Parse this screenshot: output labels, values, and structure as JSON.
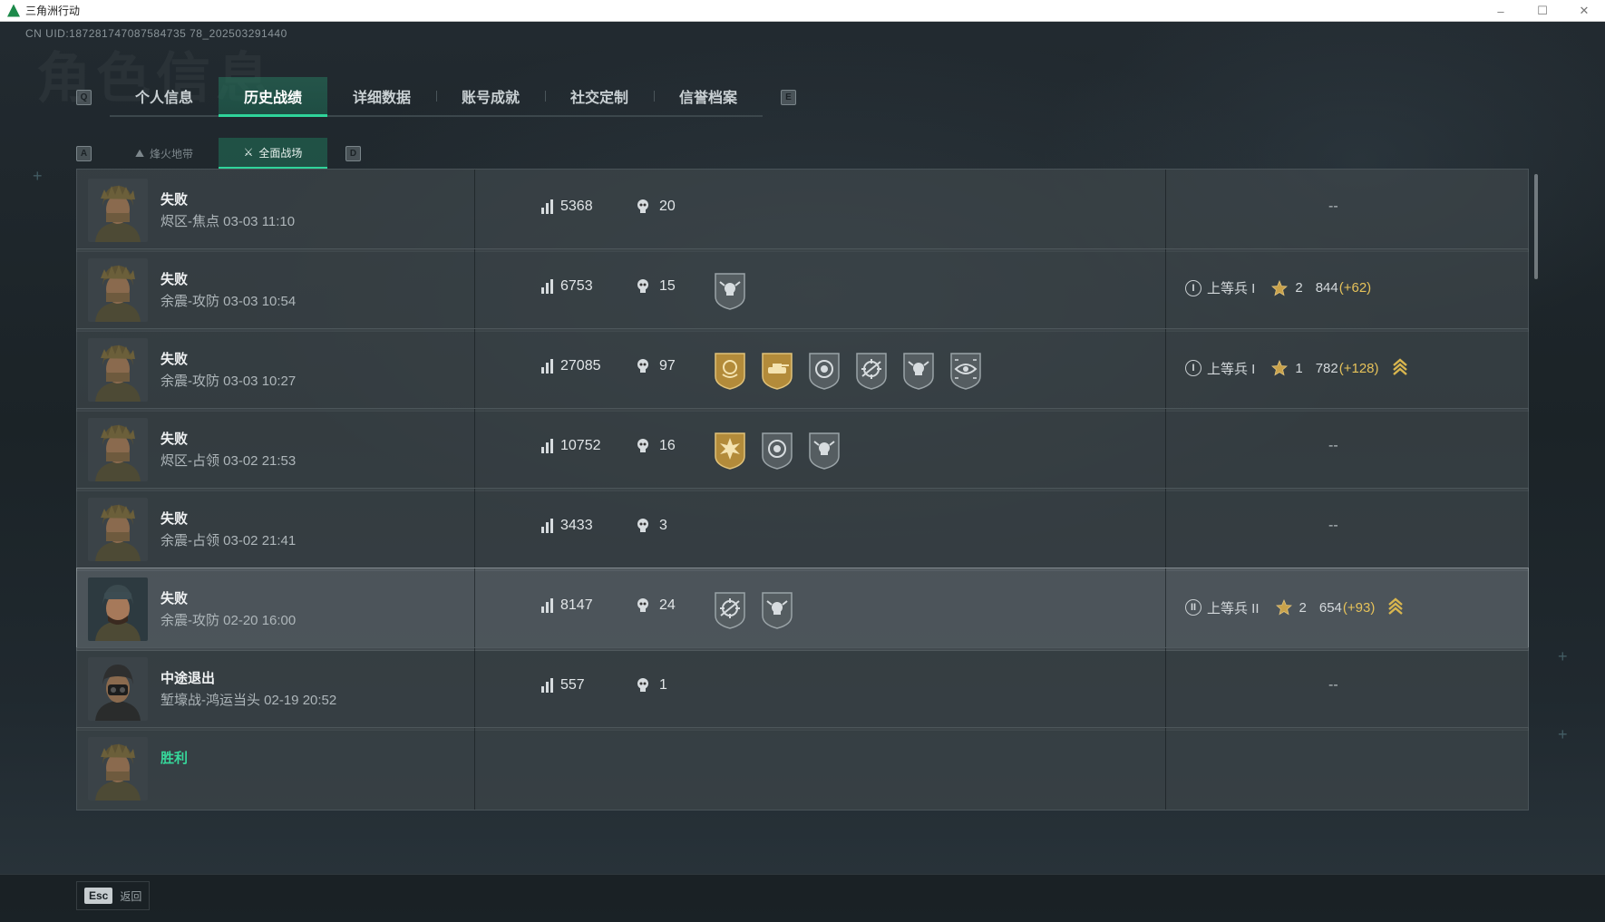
{
  "window": {
    "title": "三角洲行动",
    "controls": [
      "–",
      "☐",
      "✕"
    ]
  },
  "header": {
    "uid": "CN UID:187281747087584735 78_202503291440",
    "watermark": "角色信息"
  },
  "tabs": {
    "left_key": "Q",
    "right_key": "E",
    "items": [
      {
        "label": "个人信息"
      },
      {
        "label": "历史战绩"
      },
      {
        "label": "详细数据"
      },
      {
        "label": "账号成就"
      },
      {
        "label": "社交定制"
      },
      {
        "label": "信誉档案"
      }
    ],
    "active_index": 1
  },
  "subtabs": {
    "left_key": "A",
    "right_key": "D",
    "items": [
      {
        "label": "烽火地带"
      },
      {
        "label": "全面战场"
      }
    ],
    "active_index": 1
  },
  "rows": [
    {
      "result": "失败",
      "match": "烬区-焦点 03-03 11:10",
      "score": "5368",
      "kills": "20",
      "medals": [],
      "empty": "--",
      "rank": null,
      "avatar": "soldier-a"
    },
    {
      "result": "失败",
      "match": "余震-攻防 03-03 10:54",
      "score": "6753",
      "kills": "15",
      "medals": [
        "skull-silver"
      ],
      "rank": {
        "badge": "I",
        "name": "上等兵 I",
        "level": "2",
        "points": "844",
        "delta": "(+62)",
        "promo": false
      },
      "avatar": "soldier-a"
    },
    {
      "result": "失败",
      "match": "余震-攻防 03-03 10:27",
      "score": "27085",
      "kills": "97",
      "medals": [
        "wreath-gold",
        "tank-gold",
        "target-silver",
        "crosshair-silver",
        "skull-silver",
        "eye-silver"
      ],
      "rank": {
        "badge": "I",
        "name": "上等兵 I",
        "level": "1",
        "points": "782",
        "delta": "(+128)",
        "promo": true
      },
      "avatar": "soldier-a"
    },
    {
      "result": "失败",
      "match": "烬区-占领 03-02 21:53",
      "score": "10752",
      "kills": "16",
      "medals": [
        "burst-gold",
        "target-silver",
        "skull-silver"
      ],
      "empty": "--",
      "rank": null,
      "avatar": "soldier-a"
    },
    {
      "result": "失败",
      "match": "余震-占领 03-02 21:41",
      "score": "3433",
      "kills": "3",
      "medals": [],
      "empty": "--",
      "rank": null,
      "avatar": "soldier-a"
    },
    {
      "result": "失败",
      "match": "余震-攻防 02-20 16:00",
      "score": "8147",
      "kills": "24",
      "medals": [
        "crosshair-silver",
        "skull-silver"
      ],
      "rank": {
        "badge": "II",
        "name": "上等兵 II",
        "level": "2",
        "points": "654",
        "delta": "(+93)",
        "promo": true
      },
      "avatar": "soldier-b",
      "highlight": true
    },
    {
      "result": "中途退出",
      "match": "堑壕战-鸿运当头 02-19 20:52",
      "score": "557",
      "kills": "1",
      "medals": [],
      "empty": "--",
      "rank": null,
      "avatar": "soldier-c"
    },
    {
      "result": "胜利",
      "match": "",
      "score": "",
      "kills": "",
      "medals": [],
      "rank": null,
      "avatar": "soldier-a",
      "win": true
    }
  ],
  "footer": {
    "esc_key": "Esc",
    "back_label": "返回"
  },
  "colors": {
    "accent": "#2fd49a",
    "gold": "#c9a24a",
    "delta": "#e6c25a",
    "win": "#36d89b"
  }
}
